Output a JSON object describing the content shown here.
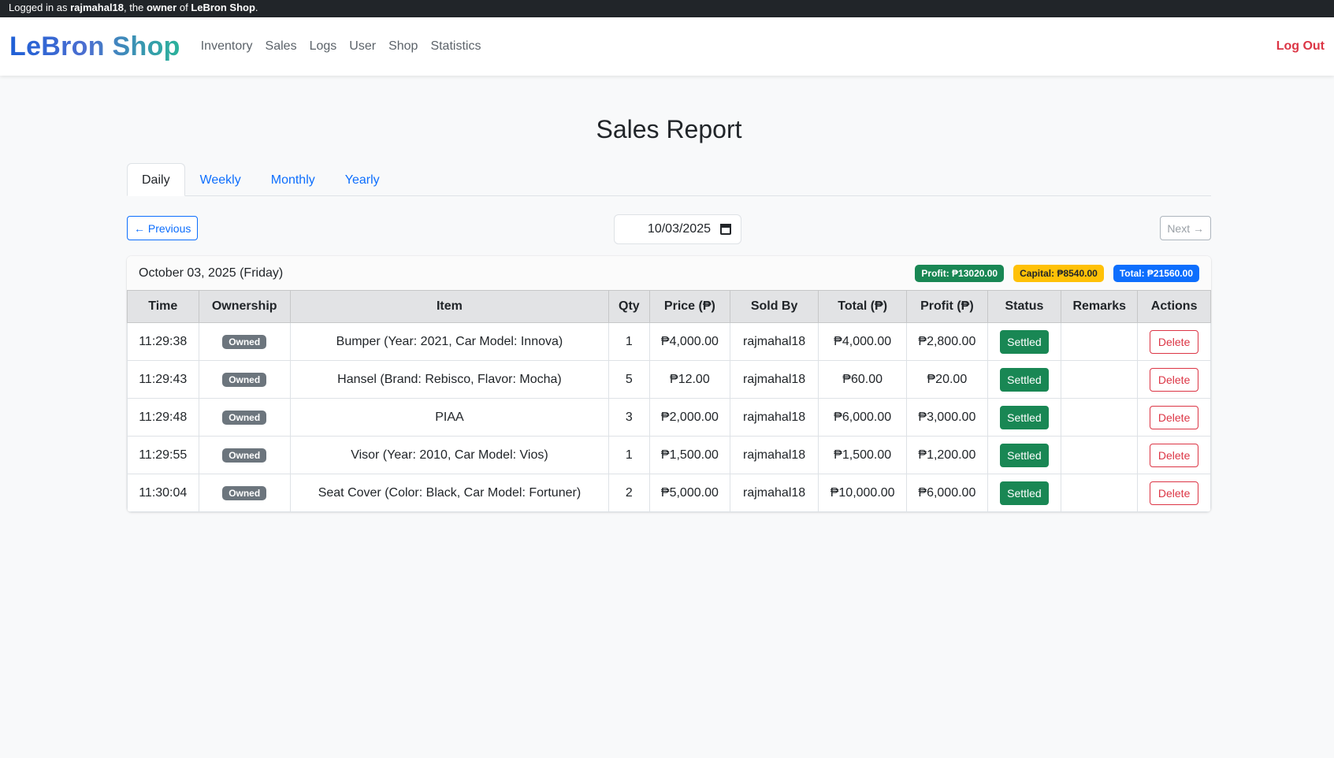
{
  "topbar": {
    "prefix": "Logged in as ",
    "user": "rajmahal18",
    "mid": ", the ",
    "role": "owner",
    "of": " of ",
    "shop": "LeBron Shop",
    "suffix": "."
  },
  "navbar": {
    "brand": "LeBron Shop",
    "links": [
      "Inventory",
      "Sales",
      "Logs",
      "User",
      "Shop",
      "Statistics"
    ],
    "logout": "Log Out"
  },
  "page": {
    "title": "Sales Report"
  },
  "tabs": [
    "Daily",
    "Weekly",
    "Monthly",
    "Yearly"
  ],
  "controls": {
    "prev": "← Previous",
    "next": "Next →",
    "date": "10/03/2025"
  },
  "report": {
    "day_label": "October 03, 2025 (Friday)",
    "profit_badge": "Profit: ₱13020.00",
    "capital_badge": "Capital: ₱8540.00",
    "total_badge": "Total: ₱21560.00"
  },
  "table": {
    "headers": [
      "Time",
      "Ownership",
      "Item",
      "Qty",
      "Price (₱)",
      "Sold By",
      "Total (₱)",
      "Profit (₱)",
      "Status",
      "Remarks",
      "Actions"
    ],
    "rows": [
      {
        "time": "11:29:38",
        "ownership": "Owned",
        "item": "Bumper (Year: 2021, Car Model: Innova)",
        "qty": "1",
        "price": "₱4,000.00",
        "sold_by": "rajmahal18",
        "total": "₱4,000.00",
        "profit": "₱2,800.00",
        "status": "Settled",
        "remarks": "",
        "action": "Delete"
      },
      {
        "time": "11:29:43",
        "ownership": "Owned",
        "item": "Hansel (Brand: Rebisco, Flavor: Mocha)",
        "qty": "5",
        "price": "₱12.00",
        "sold_by": "rajmahal18",
        "total": "₱60.00",
        "profit": "₱20.00",
        "status": "Settled",
        "remarks": "",
        "action": "Delete"
      },
      {
        "time": "11:29:48",
        "ownership": "Owned",
        "item": "PIAA",
        "qty": "3",
        "price": "₱2,000.00",
        "sold_by": "rajmahal18",
        "total": "₱6,000.00",
        "profit": "₱3,000.00",
        "status": "Settled",
        "remarks": "",
        "action": "Delete"
      },
      {
        "time": "11:29:55",
        "ownership": "Owned",
        "item": "Visor (Year: 2010, Car Model: Vios)",
        "qty": "1",
        "price": "₱1,500.00",
        "sold_by": "rajmahal18",
        "total": "₱1,500.00",
        "profit": "₱1,200.00",
        "status": "Settled",
        "remarks": "",
        "action": "Delete"
      },
      {
        "time": "11:30:04",
        "ownership": "Owned",
        "item": "Seat Cover (Color: Black, Car Model: Fortuner)",
        "qty": "2",
        "price": "₱5,000.00",
        "sold_by": "rajmahal18",
        "total": "₱10,000.00",
        "profit": "₱6,000.00",
        "status": "Settled",
        "remarks": "",
        "action": "Delete"
      }
    ]
  }
}
